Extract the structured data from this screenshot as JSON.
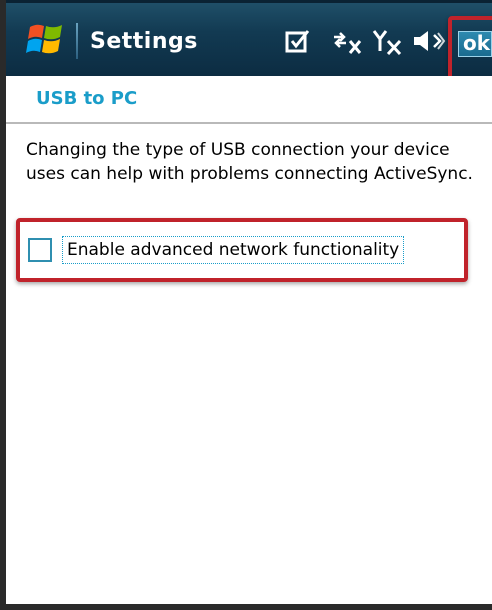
{
  "titlebar": {
    "app_title": "Settings",
    "ok_label": "ok",
    "icons": [
      "windows-start-icon",
      "notification-checkbox-icon",
      "connectivity-off-icon",
      "signal-off-icon",
      "volume-icon"
    ]
  },
  "page": {
    "title": "USB to PC",
    "description": "Changing the type of USB connection your device uses can help with problems connecting ActiveSync."
  },
  "option": {
    "label": "Enable advanced network functionality",
    "checked": false
  },
  "colors": {
    "titlebar_bg": "#123a52",
    "accent": "#1a9dc9",
    "highlight": "#c0232b"
  }
}
